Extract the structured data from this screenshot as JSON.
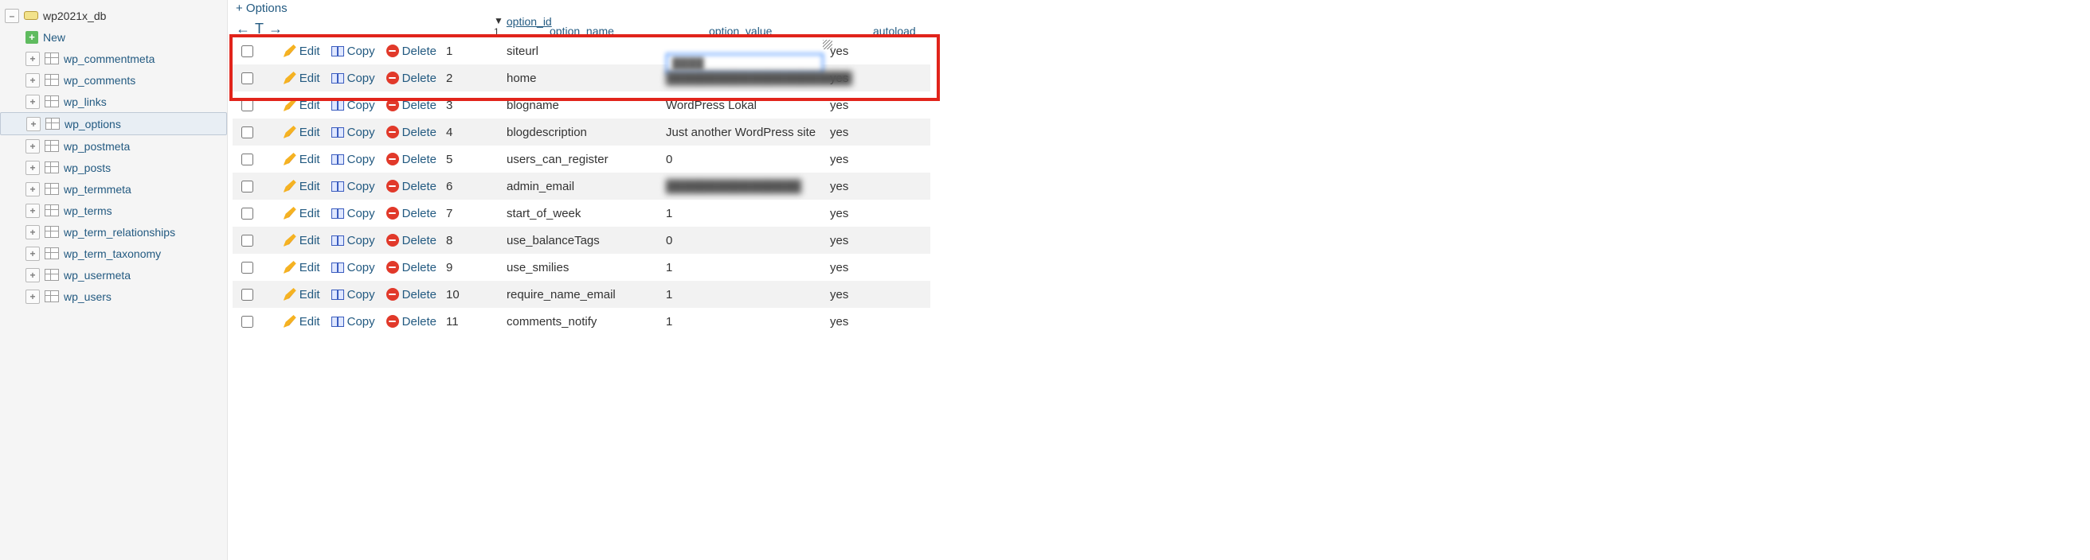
{
  "sidebar": {
    "db_name": "wp2021x_db",
    "new_label": "New",
    "tables": [
      "wp_commentmeta",
      "wp_comments",
      "wp_links",
      "wp_options",
      "wp_postmeta",
      "wp_posts",
      "wp_termmeta",
      "wp_terms",
      "wp_term_relationships",
      "wp_term_taxonomy",
      "wp_usermeta",
      "wp_users"
    ],
    "selected": "wp_options"
  },
  "grid": {
    "options_label": "+ Options",
    "sort_arrows": {
      "left": "←",
      "sym": "T",
      "right": "→"
    },
    "headers": {
      "option_id": "option_id",
      "option_name": "option_name",
      "option_value": "option_value",
      "autoload": "autoload",
      "sort_indicator": "▼  1"
    },
    "action_labels": {
      "edit": "Edit",
      "copy": "Copy",
      "delete": "Delete"
    },
    "rows": [
      {
        "id": 1,
        "name": "siteurl",
        "value": "",
        "autoload": "yes",
        "editing": true,
        "blurred": false
      },
      {
        "id": 2,
        "name": "home",
        "value": "██████████████████████",
        "autoload": "yes",
        "editing": false,
        "blurred": true
      },
      {
        "id": 3,
        "name": "blogname",
        "value": "WordPress Lokal",
        "autoload": "yes",
        "editing": false,
        "blurred": false
      },
      {
        "id": 4,
        "name": "blogdescription",
        "value": "Just another WordPress site",
        "autoload": "yes",
        "editing": false,
        "blurred": false
      },
      {
        "id": 5,
        "name": "users_can_register",
        "value": "0",
        "autoload": "yes",
        "editing": false,
        "blurred": false
      },
      {
        "id": 6,
        "name": "admin_email",
        "value": "████████████████",
        "autoload": "yes",
        "editing": false,
        "blurred": true
      },
      {
        "id": 7,
        "name": "start_of_week",
        "value": "1",
        "autoload": "yes",
        "editing": false,
        "blurred": false
      },
      {
        "id": 8,
        "name": "use_balanceTags",
        "value": "0",
        "autoload": "yes",
        "editing": false,
        "blurred": false
      },
      {
        "id": 9,
        "name": "use_smilies",
        "value": "1",
        "autoload": "yes",
        "editing": false,
        "blurred": false
      },
      {
        "id": 10,
        "name": "require_name_email",
        "value": "1",
        "autoload": "yes",
        "editing": false,
        "blurred": false
      },
      {
        "id": 11,
        "name": "comments_notify",
        "value": "1",
        "autoload": "yes",
        "editing": false,
        "blurred": false
      }
    ],
    "highlight_rows": [
      0,
      1
    ],
    "inline_edit": {
      "value": "████"
    }
  }
}
